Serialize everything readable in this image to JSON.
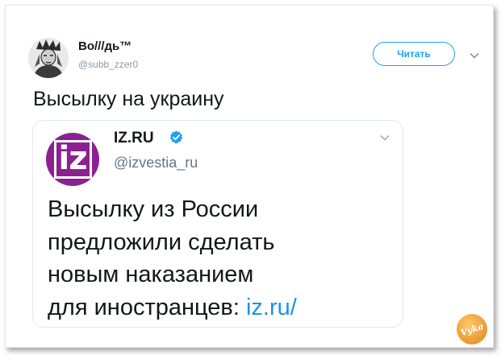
{
  "tweet": {
    "author_name": "Во///дь™",
    "author_handle": "@subb_zzer0",
    "follow_label": "Читать",
    "text": "Высылку на украину",
    "avatar_icon": "portrait-avatar-icon",
    "menu_icon": "chevron-down-icon"
  },
  "quoted": {
    "logo_text": "iz",
    "logo_color": "#8a2191",
    "name": "IZ.RU",
    "verified_icon": "verified-badge-icon",
    "handle": "@izvestia_ru",
    "menu_icon": "chevron-down-icon",
    "text_lines": [
      "Высылку из России",
      "предложили сделать",
      "новым наказанием",
      "для иностранцев:"
    ],
    "link": "iz.ru/"
  },
  "colors": {
    "accent": "#1da1f2",
    "link": "#1b95e0",
    "watermark": "#e8962e"
  },
  "watermark": {
    "text": "Vyka",
    "icon": "site-watermark-badge-icon"
  }
}
